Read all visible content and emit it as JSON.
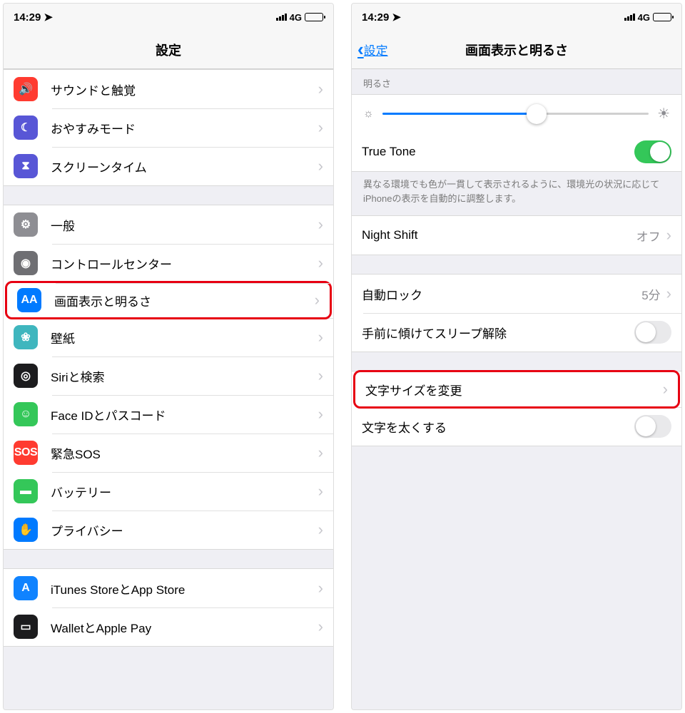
{
  "status": {
    "time": "14:29",
    "network": "4G"
  },
  "left": {
    "title": "設定",
    "groups": [
      [
        {
          "icon": "sound",
          "label": "サウンドと触覚",
          "color": "ic-red",
          "glyph": "🔊"
        },
        {
          "icon": "moon",
          "label": "おやすみモード",
          "color": "ic-purple",
          "glyph": "☾"
        },
        {
          "icon": "hourglass",
          "label": "スクリーンタイム",
          "color": "ic-hourglass",
          "glyph": "⧗"
        }
      ],
      [
        {
          "icon": "gear",
          "label": "一般",
          "color": "ic-gray",
          "glyph": "⚙"
        },
        {
          "icon": "control",
          "label": "コントロールセンター",
          "color": "ic-darkgray",
          "glyph": "◉"
        },
        {
          "icon": "display",
          "label": "画面表示と明るさ",
          "color": "ic-blue",
          "glyph": "AA",
          "highlight": true
        },
        {
          "icon": "wallpaper",
          "label": "壁紙",
          "color": "ic-teal",
          "glyph": "❀"
        },
        {
          "icon": "siri",
          "label": "Siriと検索",
          "color": "ic-black",
          "glyph": "◎"
        },
        {
          "icon": "faceid",
          "label": "Face IDとパスコード",
          "color": "ic-green",
          "glyph": "☺"
        },
        {
          "icon": "sos",
          "label": "緊急SOS",
          "color": "ic-sos",
          "glyph": "SOS"
        },
        {
          "icon": "battery",
          "label": "バッテリー",
          "color": "ic-green",
          "glyph": "▬"
        },
        {
          "icon": "privacy",
          "label": "プライバシー",
          "color": "ic-blue",
          "glyph": "✋"
        }
      ],
      [
        {
          "icon": "appstore",
          "label": "iTunes StoreとApp Store",
          "color": "ic-azure",
          "glyph": "A"
        },
        {
          "icon": "wallet",
          "label": "WalletとApple Pay",
          "color": "ic-black",
          "glyph": "▭"
        }
      ]
    ]
  },
  "right": {
    "back": "設定",
    "title": "画面表示と明るさ",
    "brightness_header": "明るさ",
    "brightness_percent": 58,
    "truetone_label": "True Tone",
    "truetone_on": true,
    "truetone_note": "異なる環境でも色が一貫して表示されるように、環境光の状況に応じてiPhoneの表示を自動的に調整します。",
    "nightshift_label": "Night Shift",
    "nightshift_value": "オフ",
    "autolock_label": "自動ロック",
    "autolock_value": "5分",
    "raise_label": "手前に傾けてスリープ解除",
    "raise_on": false,
    "textsize_label": "文字サイズを変更",
    "textsize_highlight": true,
    "bold_label": "文字を太くする",
    "bold_on": false
  }
}
